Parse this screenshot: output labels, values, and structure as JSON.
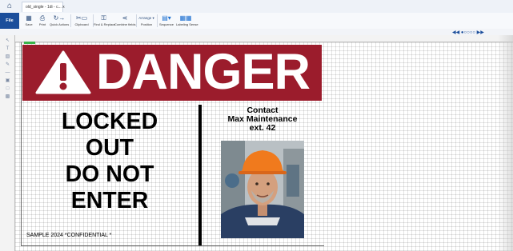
{
  "window": {
    "home_icon": "home-icon",
    "tab_title": "old_single - 1di - c...",
    "tab_close": "x"
  },
  "ribbon": {
    "file_label": "File",
    "buttons": [
      {
        "label": "Save",
        "icon": "save-icon"
      },
      {
        "label": "Print",
        "icon": "print-icon"
      },
      {
        "label": "Quick Actions",
        "icon": "quick-actions-icon"
      },
      {
        "label": "Clipboard",
        "icon": "clipboard-icon"
      },
      {
        "label": "Find & Replace",
        "icon": "find-replace-icon"
      },
      {
        "label": "Combine fields",
        "icon": "combine-fields-icon"
      },
      {
        "label": "Position",
        "icon": "arrange-icon",
        "dropdown": "Arrange"
      },
      {
        "label": "Sequence",
        "icon": "sequence-icon"
      },
      {
        "label": "Labeling Sense",
        "icon": "labeling-sense-icon"
      }
    ]
  },
  "colors": {
    "danger_red": "#9b1c2c",
    "ribbon_blue": "#1b4e9b"
  },
  "label": {
    "banner_text": "DANGER",
    "locked_lines": [
      "LOCKED",
      "OUT",
      "DO NOT",
      "ENTER"
    ],
    "contact_lines": [
      "Contact",
      "Max Maintenance",
      "ext. 42"
    ],
    "footer": "SAMPLE 2024  *CONFIDENTIAL *"
  }
}
